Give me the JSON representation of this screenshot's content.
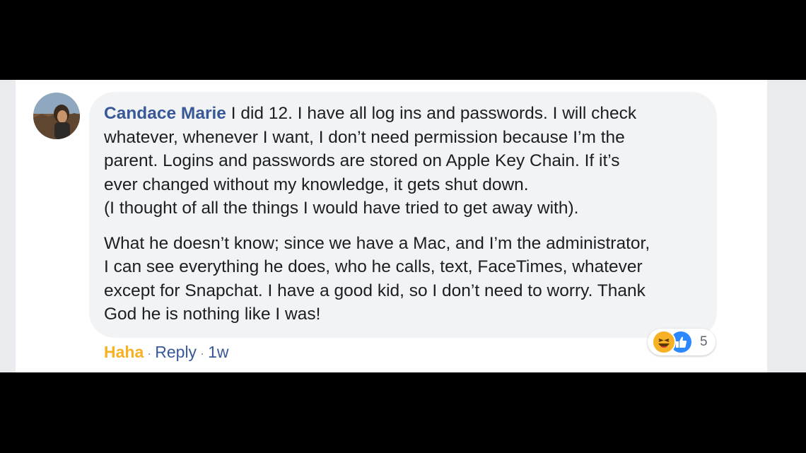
{
  "comment": {
    "author": "Candace Marie",
    "paragraph1": "I did 12. I have all log ins and passwords. I will check\nwhatever, whenever I want, I don’t need permission because I’m the\nparent. Logins and passwords are stored on Apple Key Chain. If it’s\never changed without my knowledge, it gets shut down.\n(I thought of all the things I would have tried to get away with).",
    "paragraph2": "What he doesn’t know; since we have a Mac, and I’m the administrator,\nI can see everything he does, who he calls, text, FaceTimes, whatever\nexcept for Snapchat. I have a good kid, so I don’t need to worry. Thank\nGod he is nothing like I was!",
    "reaction_icons": [
      "haha-icon",
      "like-icon"
    ],
    "reaction_count": "5"
  },
  "actions": {
    "reaction_label": "Haha",
    "reply_label": "Reply",
    "separator": "·",
    "timestamp": "1w"
  },
  "colors": {
    "author": "#385898",
    "haha": "#f7b125",
    "like": "#2d88ff",
    "bubble": "#f2f3f5"
  }
}
